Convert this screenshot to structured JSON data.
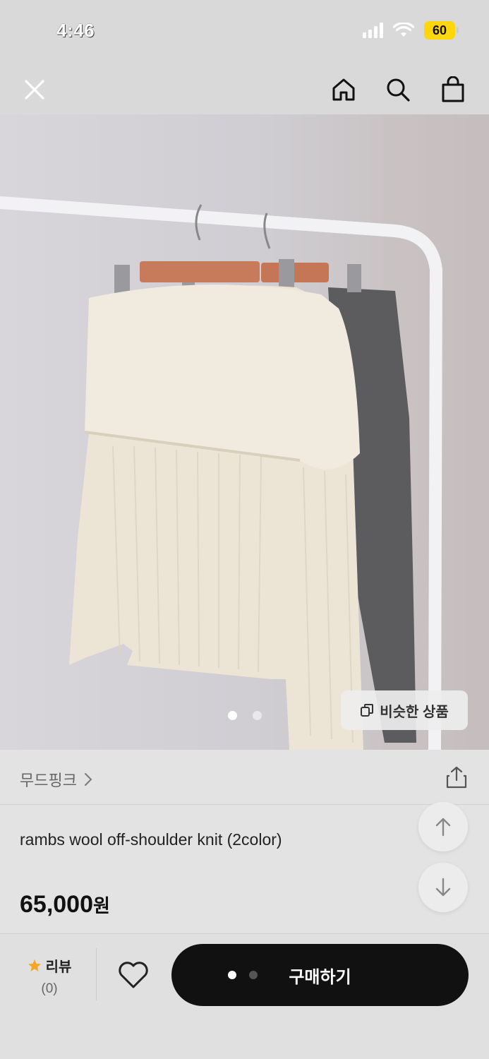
{
  "status_bar": {
    "time": "4:46",
    "battery": "60"
  },
  "header": {
    "close_icon": "close-icon",
    "home_icon": "home-icon",
    "search_icon": "search-icon",
    "bag_icon": "shopping-bag-icon"
  },
  "hero": {
    "page_indicator": {
      "count": 2,
      "active": 0
    },
    "similar_button_label": "비슷한 상품"
  },
  "product": {
    "brand": "무드핑크",
    "name": "rambs wool off-shoulder knit (2color)",
    "price": "65,000",
    "currency": "원"
  },
  "bottom_bar": {
    "review_label": "리뷰",
    "review_count": "(0)",
    "buy_label": "구매하기"
  },
  "colors": {
    "buy_button": "#111111",
    "star": "#f5a623",
    "battery": "#ffd60a"
  }
}
